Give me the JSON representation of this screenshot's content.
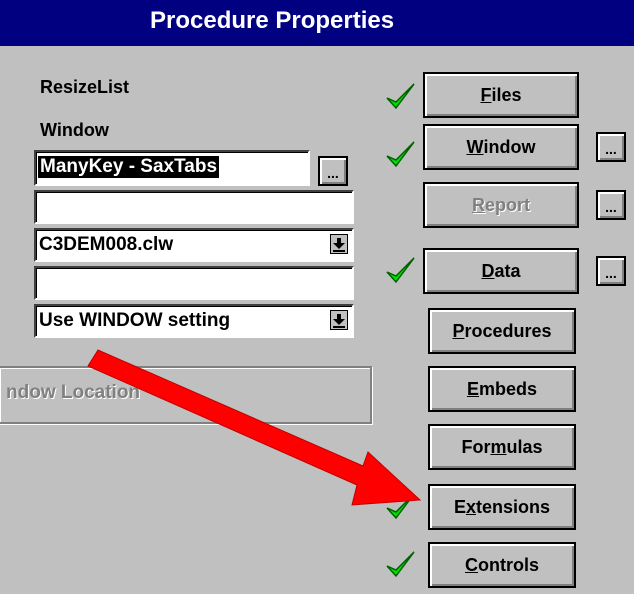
{
  "window": {
    "title": "Procedure Properties"
  },
  "labels": {
    "procedure_name": "ResizeList",
    "window_label": "Window"
  },
  "fields": {
    "window_field": "ManyKey - SaxTabs",
    "field2": "",
    "file_combo": "C3DEM008.clw",
    "field4": "",
    "window_setting_combo": "Use WINDOW setting"
  },
  "buttons": {
    "files": {
      "pre": "",
      "u": "F",
      "post": "iles"
    },
    "window": {
      "pre": "",
      "u": "W",
      "post": "indow"
    },
    "report": {
      "pre": "",
      "u": "R",
      "post": "eport"
    },
    "data": {
      "pre": "",
      "u": "D",
      "post": "ata"
    },
    "procedures": {
      "pre": "",
      "u": "P",
      "post": "rocedures"
    },
    "embeds": {
      "pre": "",
      "u": "E",
      "post": "mbeds"
    },
    "formulas": {
      "pre": "For",
      "u": "m",
      "post": "ulas"
    },
    "extensions": {
      "pre": "E",
      "u": "x",
      "post": "tensions"
    },
    "controls": {
      "pre": "",
      "u": "C",
      "post": "ontrols"
    }
  },
  "ellipsis": "...",
  "groupbox": {
    "label": "ndow Location"
  },
  "colors": {
    "titlebar": "#000080",
    "check": "#00e000",
    "arrow": "#ff0000",
    "face": "#c0c0c0"
  }
}
